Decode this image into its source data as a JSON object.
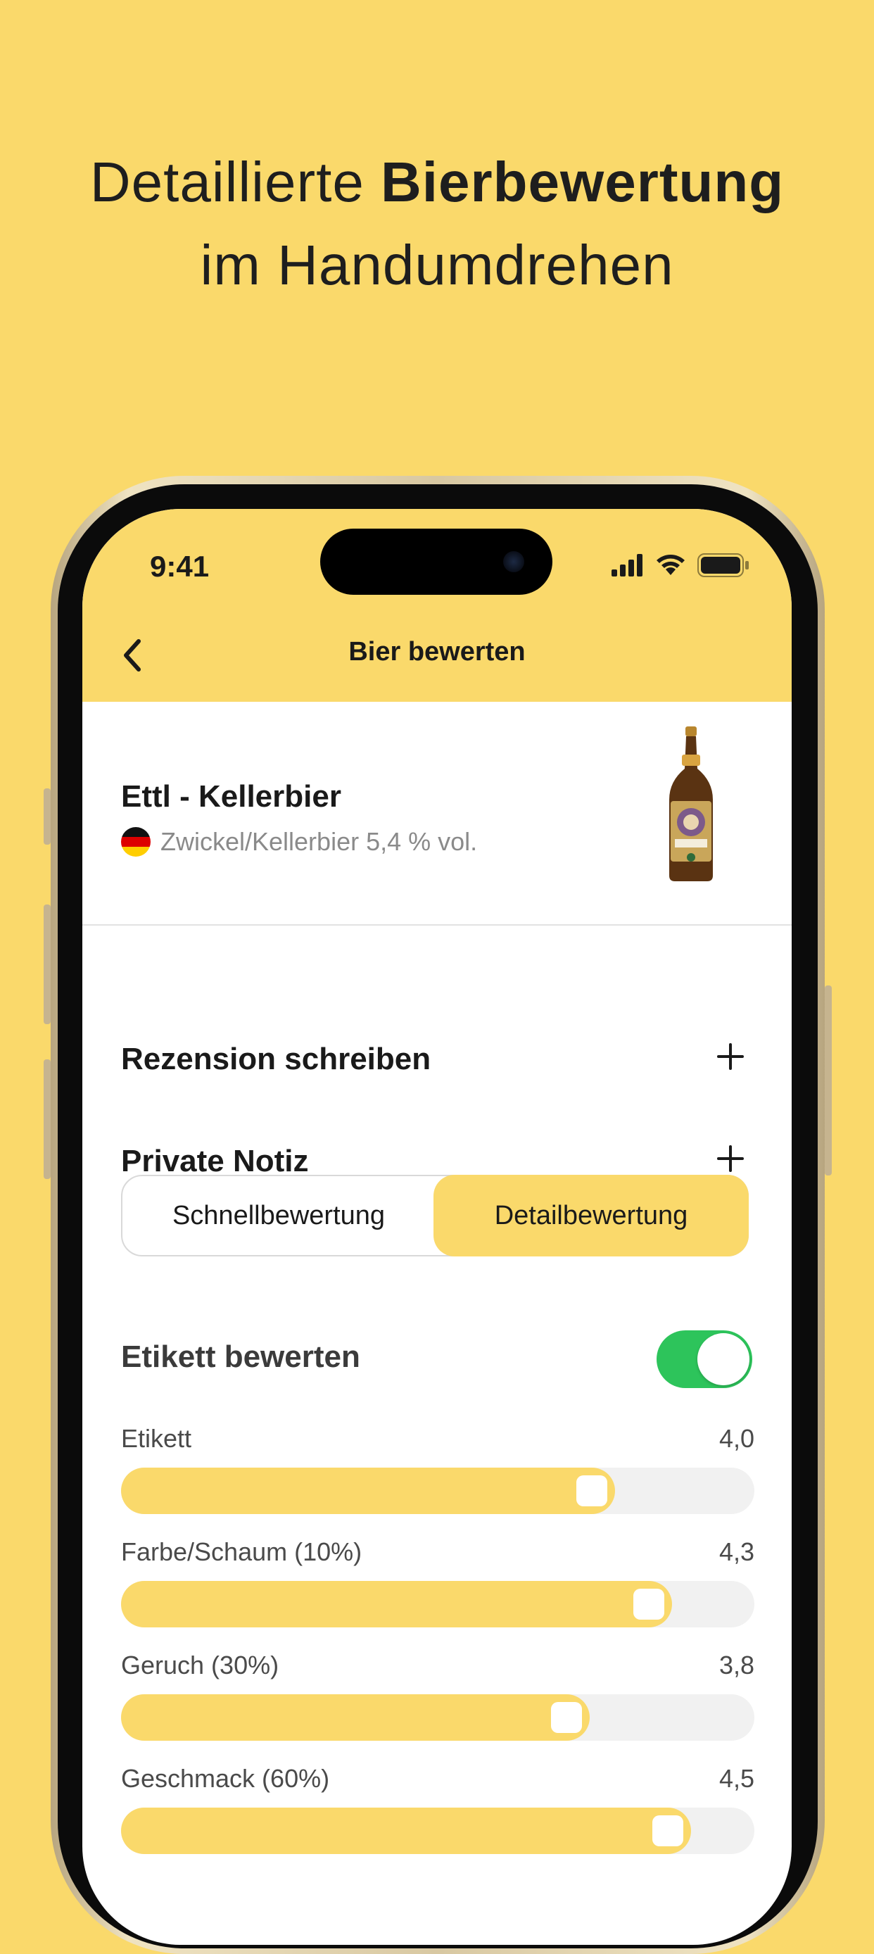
{
  "headline": {
    "line1_regular": "Detaillierte ",
    "line1_bold": "Bierbewertung",
    "line2": "im Handumdrehen"
  },
  "status_bar": {
    "time": "9:41"
  },
  "nav": {
    "back_icon": "chevron-left-icon",
    "title": "Bier bewerten"
  },
  "beer": {
    "name": "Ettl - Kellerbier",
    "meta": "Zwickel/Kellerbier 5,4 % vol.",
    "flag": "germany-flag"
  },
  "actions": [
    {
      "label": "Rezension schreiben",
      "icon": "plus-icon"
    },
    {
      "label": "Private Notiz",
      "icon": "plus-icon"
    }
  ],
  "segment": {
    "left": "Schnellbewertung",
    "right": "Detailbewertung",
    "selected": "Detailbewertung"
  },
  "label_toggle": {
    "label": "Etikett bewerten",
    "on": true
  },
  "ratings": [
    {
      "label": "Etikett",
      "value": "4,0",
      "fraction": 0.78
    },
    {
      "label": "Farbe/Schaum (10%)",
      "value": "4,3",
      "fraction": 0.87
    },
    {
      "label": "Geruch (30%)",
      "value": "3,8",
      "fraction": 0.74
    },
    {
      "label": "Geschmack (60%)",
      "value": "4,5",
      "fraction": 0.9
    }
  ],
  "colors": {
    "background": "#FAD96B",
    "accent": "#FAD96B",
    "toggle_on": "#2DC45B"
  }
}
